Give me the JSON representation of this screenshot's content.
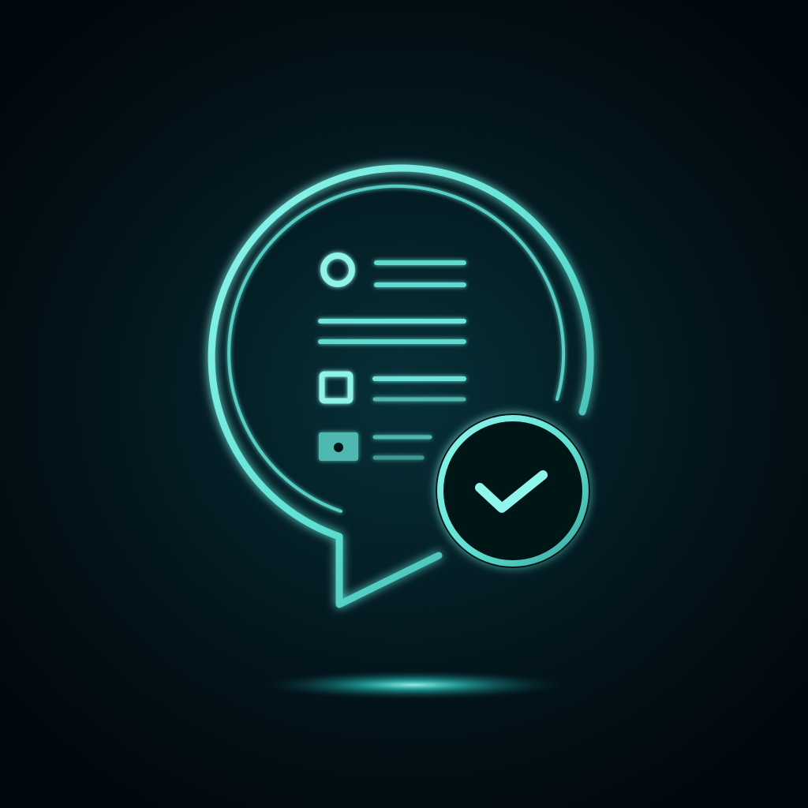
{
  "icon": {
    "subject": "chat-bubble-checklist-icon",
    "accent_color": "#6ff0e2",
    "accent_color_dim": "#4fb8b0",
    "background_color": "#02080d",
    "glow_color": "#2fe8dc",
    "checklist_items": [
      {
        "marker": "circle-outline",
        "line_count": 2
      },
      {
        "marker": "none",
        "line_count": 2
      },
      {
        "marker": "square-outline",
        "line_count": 2
      },
      {
        "marker": "square-filled",
        "line_count": 2
      }
    ],
    "badge": "checkmark-circle-icon"
  }
}
